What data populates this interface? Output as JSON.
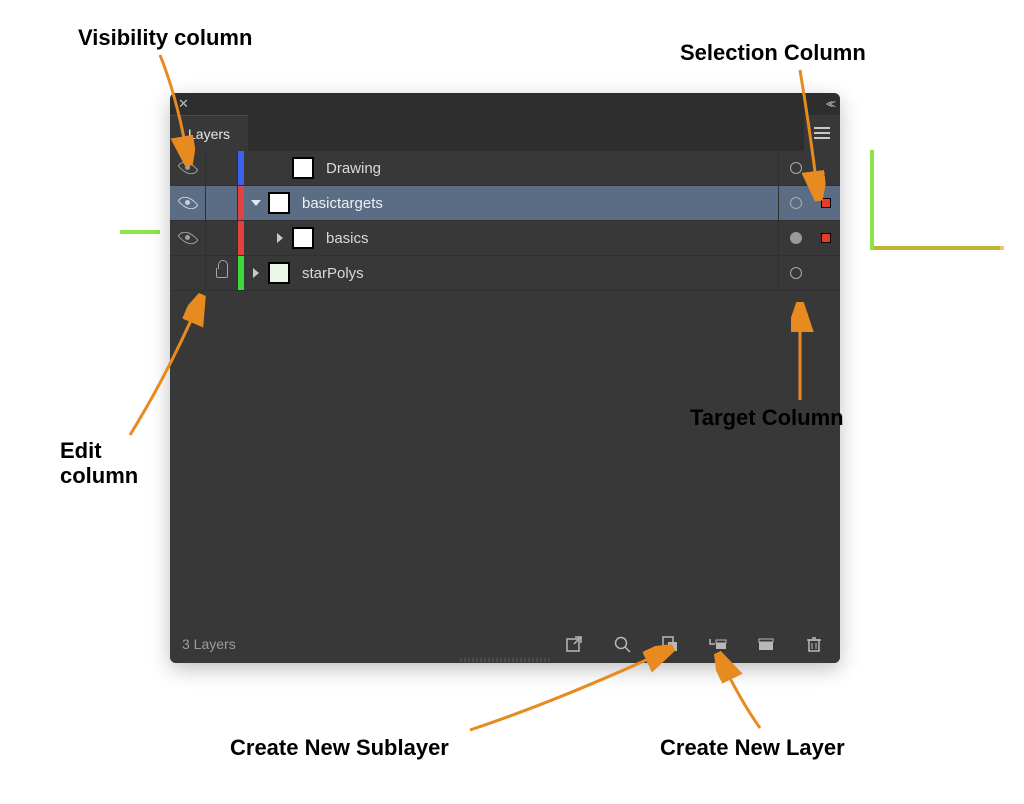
{
  "panel": {
    "title_tab": "Layers",
    "footer_status": "3 Layers"
  },
  "rows": [
    {
      "label": "Drawing",
      "visible": true,
      "locked": false,
      "color": "#3a62f0",
      "expand": "",
      "indent": 1,
      "thumb": "white",
      "target": "ring",
      "sel": false,
      "selectedRow": false
    },
    {
      "label": "basictargets",
      "visible": true,
      "locked": false,
      "color": "#e14343",
      "expand": "down",
      "indent": 0,
      "thumb": "white",
      "target": "ring",
      "sel": true,
      "selectedRow": true
    },
    {
      "label": "basics",
      "visible": true,
      "locked": false,
      "color": "#e14343",
      "expand": "right",
      "indent": 1,
      "thumb": "white",
      "target": "filled",
      "sel": true,
      "selectedRow": false
    },
    {
      "label": "starPolys",
      "visible": false,
      "locked": true,
      "color": "#3bd93b",
      "expand": "right",
      "indent": 0,
      "thumb": "green",
      "target": "ring",
      "sel": false,
      "selectedRow": false
    }
  ],
  "annotations": {
    "visibility": "Visibility column",
    "edit": "Edit\ncolumn",
    "selection": "Selection Column",
    "target": "Target Column",
    "sublayer": "Create New Sublayer",
    "newlayer": "Create New Layer"
  },
  "footer_buttons": [
    "export-icon",
    "locate-icon",
    "clip-mask-icon",
    "new-sublayer-icon",
    "new-layer-icon",
    "trash-icon"
  ]
}
